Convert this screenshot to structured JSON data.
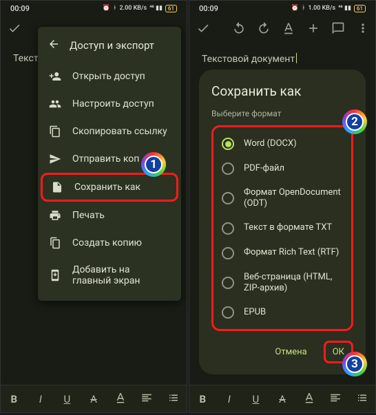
{
  "statusbar": {
    "time": "00:09",
    "battery": "61"
  },
  "doc": {
    "title_truncated": "Тексто",
    "title_full": "Текстовой документ"
  },
  "menu": {
    "header": "Доступ и экспорт",
    "items": [
      {
        "label": "Открыть доступ"
      },
      {
        "label": "Настроить доступ"
      },
      {
        "label": "Скопировать ссылку"
      },
      {
        "label": "Отправить коп"
      },
      {
        "label": "Сохранить как"
      },
      {
        "label": "Печать"
      },
      {
        "label": "Создать копию"
      },
      {
        "label": "Добавить на главный экран"
      }
    ]
  },
  "toolbar": {
    "bold": "B",
    "italic": "I",
    "underline": "U",
    "strike": "A"
  },
  "dialog": {
    "title": "Сохранить как",
    "subtitle": "Выберите формат",
    "options": [
      {
        "label": "Word (DOCX)",
        "selected": true
      },
      {
        "label": "PDF-файл",
        "selected": false
      },
      {
        "label": "Формат OpenDocument (ODT)",
        "selected": false
      },
      {
        "label": "Текст в формате TXT",
        "selected": false
      },
      {
        "label": "Формат Rich Text (RTF)",
        "selected": false
      },
      {
        "label": "Веб-страница (HTML, ZIP-архив)",
        "selected": false
      },
      {
        "label": "EPUB",
        "selected": false
      }
    ],
    "cancel": "Отмена",
    "ok": "ОК"
  },
  "callouts": {
    "one": "1",
    "two": "2",
    "three": "3"
  }
}
